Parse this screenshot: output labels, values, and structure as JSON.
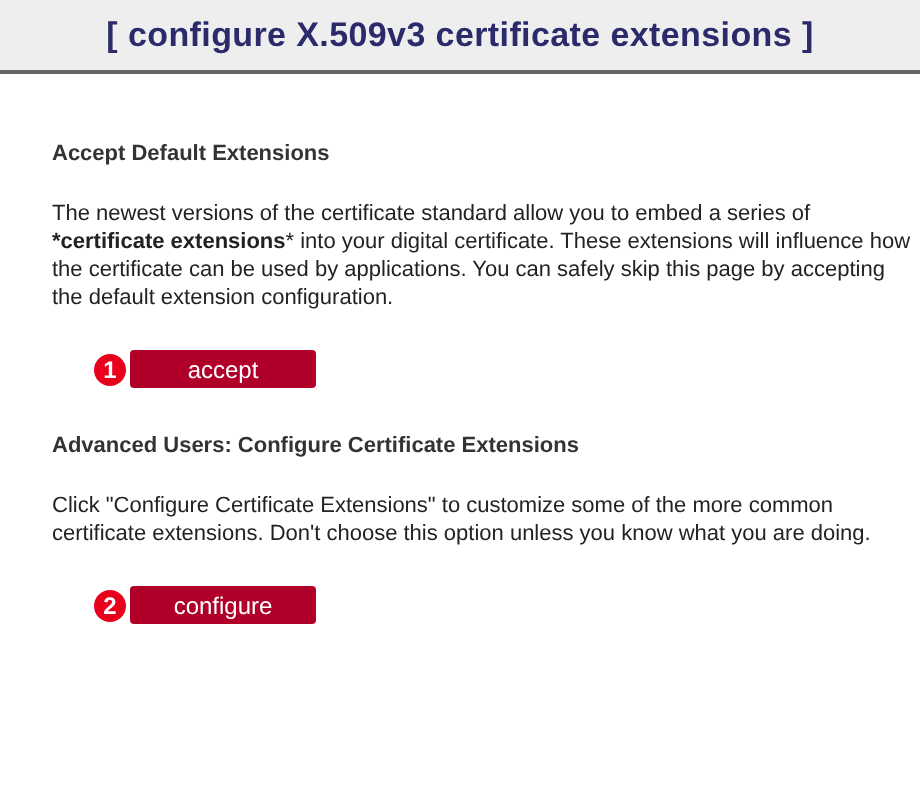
{
  "header": {
    "title": "[ configure X.509v3 certificate extensions ]"
  },
  "sections": [
    {
      "heading": "Accept Default Extensions",
      "text": "The newest versions of the certificate standard allow you to embed a series of ***certificate extensions*** into your digital certificate. These extensions will influence how the certificate can be used by applications. You can safely skip this page by accepting the default extension configuration.",
      "step": "1",
      "button": "accept"
    },
    {
      "heading": "Advanced Users: Configure Certificate Extensions",
      "text": "Click \"Configure Certificate Extensions\" to customize some of the more common certificate extensions. Don't choose this option unless you know what you are doing.",
      "step": "2",
      "button": "configure"
    }
  ]
}
